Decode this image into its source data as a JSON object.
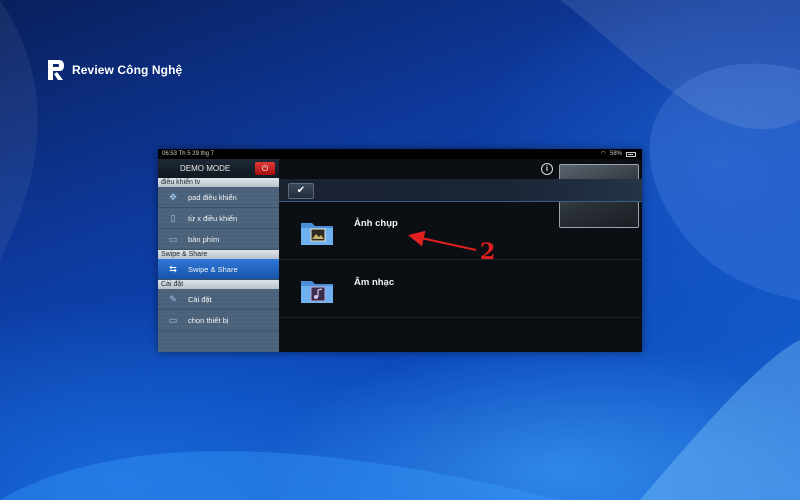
{
  "brand": {
    "name": "Review Công Nghệ"
  },
  "status": {
    "time": "06:53  Th 5 29 thg 7",
    "battery": "58%"
  },
  "sidebar": {
    "demo_label": "DEMO MODE",
    "sections": [
      {
        "header": "điều khiển tv",
        "items": [
          {
            "label": "pad điều khiển",
            "icon": "dpad-icon"
          },
          {
            "label": "từ x điều khiển",
            "icon": "remote-icon"
          },
          {
            "label": "bàn phím",
            "icon": "keyboard-icon"
          }
        ]
      },
      {
        "header": "Swipe & Share",
        "items": [
          {
            "label": "Swipe & Share",
            "icon": "swipe-share-icon",
            "active": true
          }
        ]
      },
      {
        "header": "Cài đặt",
        "items": [
          {
            "label": "Cài đặt",
            "icon": "wrench-icon"
          },
          {
            "label": "chọn thiết bị",
            "icon": "tv-icon"
          }
        ]
      }
    ]
  },
  "main": {
    "rows": [
      {
        "label": "Ảnh chụp",
        "icon": "photo-folder-icon"
      },
      {
        "label": "Âm nhạc",
        "icon": "music-folder-icon"
      }
    ]
  },
  "annotation": {
    "number": "2",
    "color": "#e02020"
  },
  "colors": {
    "accent": "#1f66c4",
    "power": "#c81d1d"
  }
}
